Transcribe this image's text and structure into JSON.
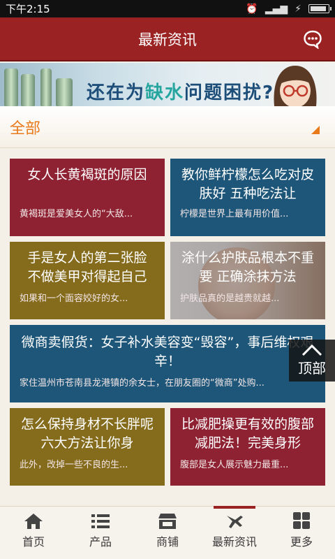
{
  "status_bar": {
    "time": "下午2:15"
  },
  "header": {
    "title": "最新资讯"
  },
  "banner": {
    "text_pre": "还在为",
    "text_hl": "缺水",
    "text_post": "问题困扰?"
  },
  "filter": {
    "label": "全部"
  },
  "articles": [
    {
      "title": "女人长黄褐斑的原因",
      "summary": "黄褐斑是爱美女人的“大敌..."
    },
    {
      "title": "教你鲜柠檬怎么吃对皮肤好 五种吃法让",
      "summary": "柠檬是世界上最有用价值..."
    },
    {
      "title": "手是女人的第二张脸 不做美甲对得起自己",
      "summary": "如果和一个面容姣好的女..."
    },
    {
      "title": "涂什么护肤品根本不重要 正确涂抹方法",
      "summary": "护肤品真的是越贵就越..."
    },
    {
      "title": "微商卖假货：女子补水美容变“毁容”，事后维权艰辛！",
      "summary": "家住温州市苍南县龙港镇的余女士，在朋友圈的“微商”处购..."
    },
    {
      "title": "怎么保持身材不长胖呢 六大方法让你身",
      "summary": "此外，改掉一些不良的生..."
    },
    {
      "title": "比减肥操更有效的腹部减肥法！完美身形",
      "summary": "腹部是女人展示魅力最重..."
    }
  ],
  "fab": {
    "label": "顶部"
  },
  "tabs": [
    {
      "label": "首页",
      "icon": "home-icon"
    },
    {
      "label": "产品",
      "icon": "list-icon"
    },
    {
      "label": "商铺",
      "icon": "store-icon"
    },
    {
      "label": "最新资讯",
      "icon": "news-icon",
      "active": true
    },
    {
      "label": "更多",
      "icon": "grid-icon"
    }
  ],
  "colors": {
    "header": "#9b2222",
    "card_red": "#8e2233",
    "card_blue": "#1d5679",
    "card_olive": "#856b1c",
    "filter_orange": "#e87a1b"
  }
}
